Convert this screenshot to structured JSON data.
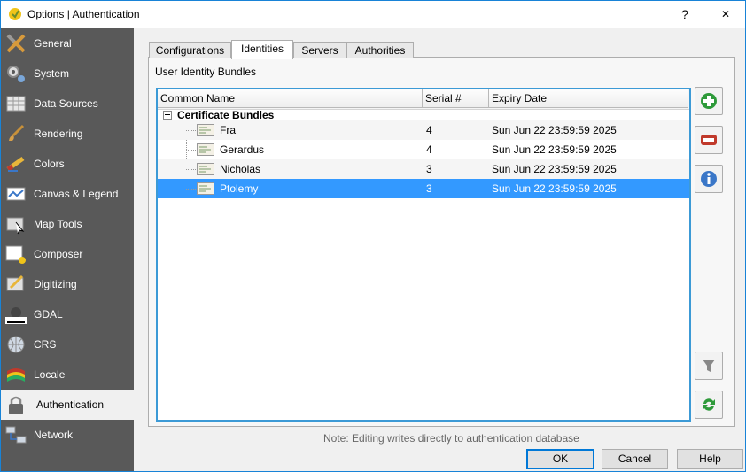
{
  "window": {
    "title": "Options | Authentication",
    "help_glyph": "?",
    "close_glyph": "✕"
  },
  "sidebar": {
    "items": [
      {
        "label": "General",
        "icon": "tools-icon"
      },
      {
        "label": "System",
        "icon": "gears-icon"
      },
      {
        "label": "Data Sources",
        "icon": "table-icon"
      },
      {
        "label": "Rendering",
        "icon": "brush-icon"
      },
      {
        "label": "Colors",
        "icon": "palette-icon"
      },
      {
        "label": "Canvas & Legend",
        "icon": "map-canvas-icon"
      },
      {
        "label": "Map Tools",
        "icon": "map-tools-icon"
      },
      {
        "label": "Composer",
        "icon": "composer-icon"
      },
      {
        "label": "Digitizing",
        "icon": "digitizing-icon"
      },
      {
        "label": "GDAL",
        "icon": "gdal-icon"
      },
      {
        "label": "CRS",
        "icon": "globe-icon"
      },
      {
        "label": "Locale",
        "icon": "flag-icon"
      },
      {
        "label": "Authentication",
        "icon": "padlock-icon"
      },
      {
        "label": "Network",
        "icon": "network-icon"
      }
    ],
    "active": "Authentication"
  },
  "tabs": [
    {
      "label": "Configurations"
    },
    {
      "label": "Identities"
    },
    {
      "label": "Servers"
    },
    {
      "label": "Authorities"
    }
  ],
  "active_tab": "Identities",
  "group_label": "User Identity Bundles",
  "table": {
    "columns": [
      "Common Name",
      "Serial #",
      "Expiry Date"
    ],
    "group": "Certificate Bundles",
    "rows": [
      {
        "name": "Fra",
        "serial": "4",
        "expiry": "Sun Jun 22 23:59:59 2025"
      },
      {
        "name": "Gerardus",
        "serial": "4",
        "expiry": "Sun Jun 22 23:59:59 2025"
      },
      {
        "name": "Nicholas",
        "serial": "3",
        "expiry": "Sun Jun 22 23:59:59 2025"
      },
      {
        "name": "Ptolemy",
        "serial": "3",
        "expiry": "Sun Jun 22 23:59:59 2025"
      }
    ],
    "selected_row": "Ptolemy"
  },
  "side_buttons": [
    "add-icon",
    "remove-icon",
    "info-icon",
    "filter-icon",
    "refresh-icon"
  ],
  "note": "Note: Editing writes directly to authentication database",
  "buttons": {
    "ok": "OK",
    "cancel": "Cancel",
    "help": "Help"
  },
  "colors": {
    "accent": "#3399ff",
    "sidebar_bg": "#595959",
    "border_focus": "#3c9ad6"
  }
}
